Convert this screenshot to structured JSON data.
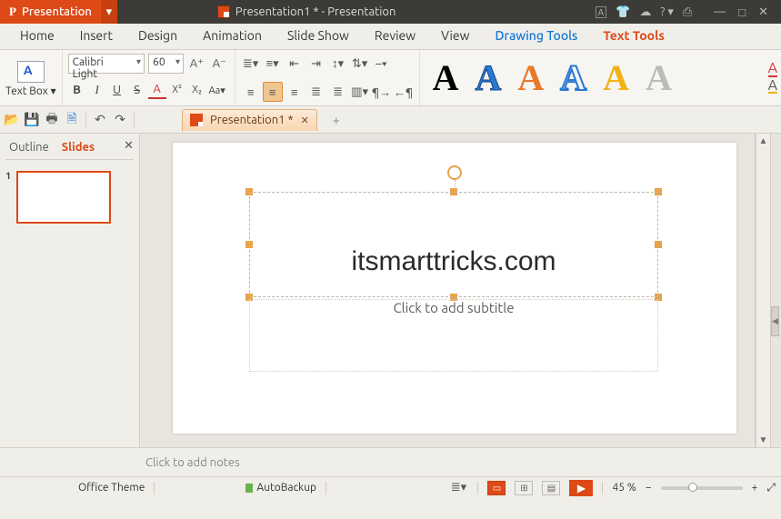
{
  "titlebar": {
    "app_label": "Presentation",
    "doc_title": "Presentation1 * - Presentation"
  },
  "sys_icons": {
    "a": "A",
    "shirt": "👕",
    "cloud": "☁",
    "help": "? ▾",
    "shot": "⎙"
  },
  "menubar": {
    "home": "Home",
    "insert": "Insert",
    "design": "Design",
    "animation": "Animation",
    "slideshow": "Slide Show",
    "review": "Review",
    "view": "View",
    "drawing": "Drawing Tools",
    "text": "Text Tools"
  },
  "ribbon": {
    "textbox_label": "Text Box ▾",
    "font_name": "Calibri Light",
    "font_size": "60",
    "grow": "A⁺",
    "shrink": "A⁻",
    "bold": "B",
    "italic": "I",
    "underline": "U",
    "strike": "S",
    "color": "A",
    "sup": "X²",
    "sub": "X₂",
    "case": "Aa▾"
  },
  "qbar": {
    "tab_label": "Presentation1 *"
  },
  "sidepane": {
    "outline": "Outline",
    "slides": "Slides",
    "close": "✕",
    "num": "1"
  },
  "slide": {
    "title": "itsmarttricks.com",
    "subtitle_placeholder": "Click to add subtitle"
  },
  "notes": {
    "placeholder": "Click to add notes"
  },
  "status": {
    "theme": "Office Theme",
    "autobackup": "AutoBackup",
    "zoom": "45 %",
    "minus": "−",
    "plus": "+"
  }
}
